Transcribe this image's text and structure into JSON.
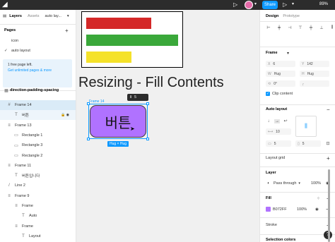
{
  "topbar": {
    "share_label": "Share",
    "zoom": "89%"
  },
  "left_panel": {
    "tabs": {
      "layers": "Layers",
      "assets": "Assets",
      "file": "auto lay..."
    },
    "pages_title": "Pages",
    "pages": [
      {
        "label": "icon",
        "current": false
      },
      {
        "label": "auto layout",
        "current": true
      }
    ],
    "banner": {
      "line1": "1 free page left.",
      "link": "Get unlimited pages & more"
    },
    "root_frame": "direction-padding-spacing",
    "layers": [
      {
        "label": "Frame 14",
        "indent": 0,
        "glyph": "#",
        "state": "selected"
      },
      {
        "label": "버튼",
        "indent": 1,
        "glyph": "T",
        "state": "sub"
      },
      {
        "label": "Frame 13",
        "indent": 0,
        "glyph": "≡",
        "state": ""
      },
      {
        "label": "Rectangle 1",
        "indent": 1,
        "glyph": "▭",
        "state": ""
      },
      {
        "label": "Rectangle 3",
        "indent": 1,
        "glyph": "▭",
        "state": ""
      },
      {
        "label": "Rectangle 2",
        "indent": 1,
        "glyph": "▭",
        "state": ""
      },
      {
        "label": "Frame 11",
        "indent": 0,
        "glyph": "≡",
        "state": ""
      },
      {
        "label": "버튼입니다",
        "indent": 1,
        "glyph": "T",
        "state": ""
      },
      {
        "label": "Line 2",
        "indent": 0,
        "glyph": "/",
        "state": ""
      },
      {
        "label": "Frame 9",
        "indent": 0,
        "glyph": "≡",
        "state": ""
      },
      {
        "label": "Frame",
        "indent": 1,
        "glyph": "≡",
        "state": ""
      },
      {
        "label": "Auto",
        "indent": 2,
        "glyph": "T",
        "state": ""
      },
      {
        "label": "Frame",
        "indent": 1,
        "glyph": "≡",
        "state": ""
      },
      {
        "label": "Layout",
        "indent": 2,
        "glyph": "T",
        "state": ""
      }
    ]
  },
  "canvas": {
    "bars": [
      {
        "color": "#d42828"
      },
      {
        "color": "#3aa83a"
      },
      {
        "color": "#f5e22a"
      }
    ],
    "title": "Resizing - Fill Contents",
    "frame_label": "Frame 14",
    "spacing_value": "5",
    "button_text": "버튼",
    "button_color": "#b072ff",
    "size_label": "Hug × Hug"
  },
  "right_panel": {
    "tabs": {
      "design": "Design",
      "prototype": "Prototype"
    },
    "frame_section": "Frame",
    "x_label": "X",
    "x_value": "6",
    "y_label": "Y",
    "y_value": "142",
    "w_label": "W",
    "w_value": "Hug",
    "h_label": "H",
    "h_value": "Hug",
    "rotation": "0°",
    "clip_content": "Clip content",
    "auto_layout_title": "Auto layout",
    "gap_value": "10",
    "padding_h": "5",
    "padding_v": "5",
    "layout_grid": "Layout grid",
    "layer_title": "Layer",
    "pass_through": "Pass through",
    "layer_opacity": "100%",
    "fill_title": "Fill",
    "fill_hex": "B072FF",
    "fill_opacity": "100%",
    "stroke_title": "Stroke",
    "selection_colors": "Selection colors"
  }
}
